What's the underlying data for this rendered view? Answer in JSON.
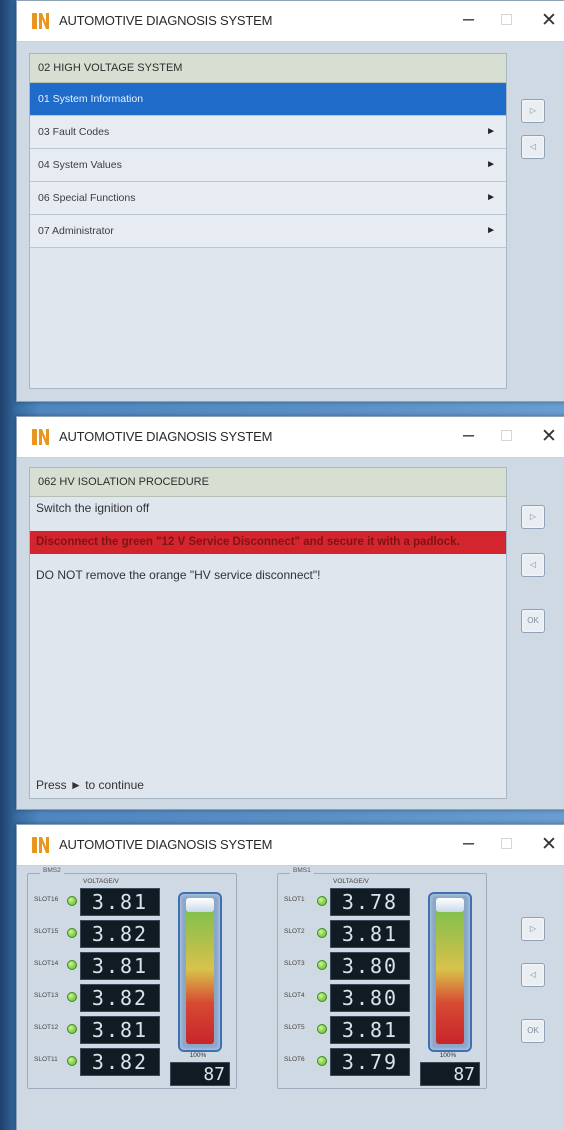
{
  "windows": [
    {
      "title": "AUTOMOTIVE DIAGNOSIS SYSTEM",
      "header": "02 HIGH VOLTAGE SYSTEM",
      "menu": [
        {
          "label": "01 System Information",
          "selected": true,
          "has_arrow": false
        },
        {
          "label": "03 Fault Codes",
          "has_arrow": true
        },
        {
          "label": "04 System Values",
          "has_arrow": true
        },
        {
          "label": "06 Special Functions",
          "has_arrow": true
        },
        {
          "label": "07 Administrator",
          "has_arrow": true
        }
      ],
      "buttons": [
        "▷",
        "◁"
      ]
    },
    {
      "title": "AUTOMOTIVE DIAGNOSIS SYSTEM",
      "header": "062 HV ISOLATION PROCEDURE",
      "line1": "Switch the ignition off",
      "warning": "Disconnect the green \"12 V Service Disconnect\" and secure it with a padlock.",
      "line3": "DO NOT remove the orange \"HV service disconnect\"!",
      "footer": "Press ► to continue",
      "buttons": [
        "▷",
        "◁",
        "OK"
      ]
    },
    {
      "title": "AUTOMOTIVE DIAGNOSIS SYSTEM",
      "groups": [
        {
          "label": "BMS2",
          "voltage_label": "VOLTAGE/V",
          "slots": [
            {
              "name": "SLOT16",
              "value": "3.81"
            },
            {
              "name": "SLOT15",
              "value": "3.82"
            },
            {
              "name": "SLOT14",
              "value": "3.81"
            },
            {
              "name": "SLOT13",
              "value": "3.82"
            },
            {
              "name": "SLOT12",
              "value": "3.81"
            },
            {
              "name": "SLOT11",
              "value": "3.82"
            }
          ],
          "percent": "100%",
          "soc": "87"
        },
        {
          "label": "BMS1",
          "voltage_label": "VOLTAGE/V",
          "slots": [
            {
              "name": "SLOT1",
              "value": "3.78"
            },
            {
              "name": "SLOT2",
              "value": "3.81"
            },
            {
              "name": "SLOT3",
              "value": "3.80"
            },
            {
              "name": "SLOT4",
              "value": "3.80"
            },
            {
              "name": "SLOT5",
              "value": "3.81"
            },
            {
              "name": "SLOT6",
              "value": "3.79"
            }
          ],
          "percent": "100%",
          "soc": "87"
        }
      ],
      "buttons": [
        "▷",
        "◁",
        "OK"
      ]
    }
  ],
  "colors": {
    "selected_blue": "#1f6bc9",
    "warning_red": "#d4242e",
    "logo_orange": "#e8961e"
  }
}
